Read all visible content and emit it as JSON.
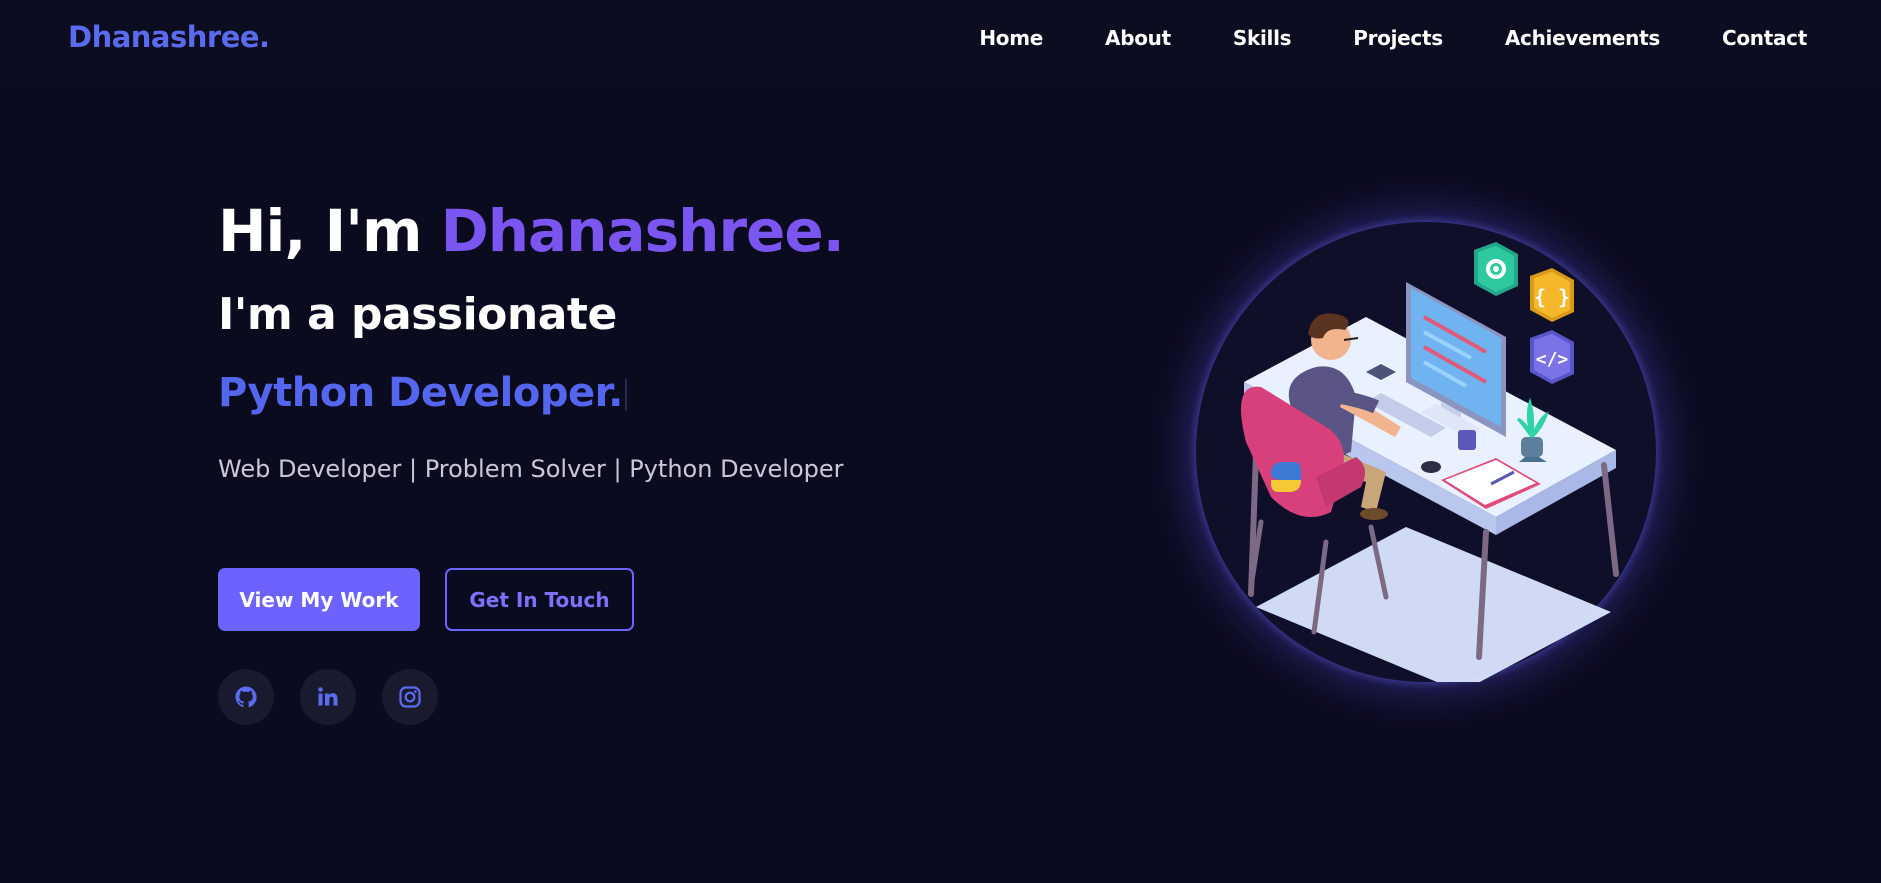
{
  "brand": {
    "logo": "Dhanashree."
  },
  "nav": {
    "items": [
      {
        "label": "Home"
      },
      {
        "label": "About"
      },
      {
        "label": "Skills"
      },
      {
        "label": "Projects"
      },
      {
        "label": "Achievements"
      },
      {
        "label": "Contact"
      }
    ]
  },
  "hero": {
    "greeting": "Hi, I'm ",
    "name": "Dhanashree.",
    "subtitle": "I'm a passionate",
    "role": "Python Developer.",
    "tagline": "Web Developer | Problem Solver | Python Developer",
    "primary_button": "View My Work",
    "secondary_button": "Get In Touch"
  },
  "social": [
    {
      "icon": "github-icon"
    },
    {
      "icon": "linkedin-icon"
    },
    {
      "icon": "instagram-icon"
    }
  ],
  "colors": {
    "background": "#0b0b1f",
    "accent": "#6c63ff",
    "name_purple": "#7b55f0",
    "role_blue": "#5566ee"
  }
}
